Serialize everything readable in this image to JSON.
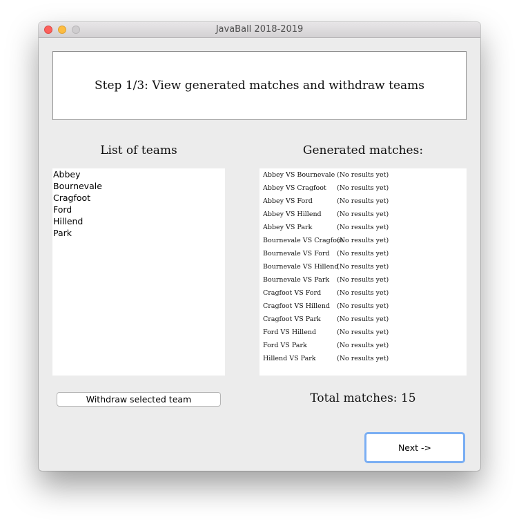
{
  "window": {
    "title": "JavaBall 2018-2019"
  },
  "step": {
    "text": "Step 1/3: View generated matches and withdraw teams"
  },
  "teams": {
    "heading": "List of teams",
    "items": [
      "Abbey",
      "Bournevale",
      "Cragfoot",
      "Ford",
      "Hillend",
      "Park"
    ],
    "withdraw_label": "Withdraw selected team"
  },
  "matches": {
    "heading": "Generated matches:",
    "rows": [
      {
        "name": "Abbey VS Bournevale",
        "result": "(No results yet)"
      },
      {
        "name": "Abbey VS Cragfoot",
        "result": "(No results yet)"
      },
      {
        "name": "Abbey VS Ford",
        "result": "(No results yet)"
      },
      {
        "name": "Abbey VS Hillend",
        "result": "(No results yet)"
      },
      {
        "name": "Abbey VS Park",
        "result": "(No results yet)"
      },
      {
        "name": "Bournevale VS Cragfoot",
        "result": "(No results yet)"
      },
      {
        "name": "Bournevale VS Ford",
        "result": "(No results yet)"
      },
      {
        "name": "Bournevale VS Hillend",
        "result": "(No results yet)"
      },
      {
        "name": "Bournevale VS Park",
        "result": "(No results yet)"
      },
      {
        "name": "Cragfoot VS Ford",
        "result": "(No results yet)"
      },
      {
        "name": "Cragfoot VS Hillend",
        "result": "(No results yet)"
      },
      {
        "name": "Cragfoot VS Park",
        "result": "(No results yet)"
      },
      {
        "name": "Ford VS Hillend",
        "result": "(No results yet)"
      },
      {
        "name": "Ford VS Park",
        "result": "(No results yet)"
      },
      {
        "name": "Hillend VS Park",
        "result": "(No results yet)"
      }
    ],
    "total_label": "Total matches: 15"
  },
  "navigation": {
    "next_label": "Next ->"
  },
  "colors": {
    "close": "#fc605c",
    "minimize": "#fdbc40",
    "zoom": "#cfcdcf",
    "focus_ring": "#7aaef3",
    "window_bg": "#ececec"
  }
}
